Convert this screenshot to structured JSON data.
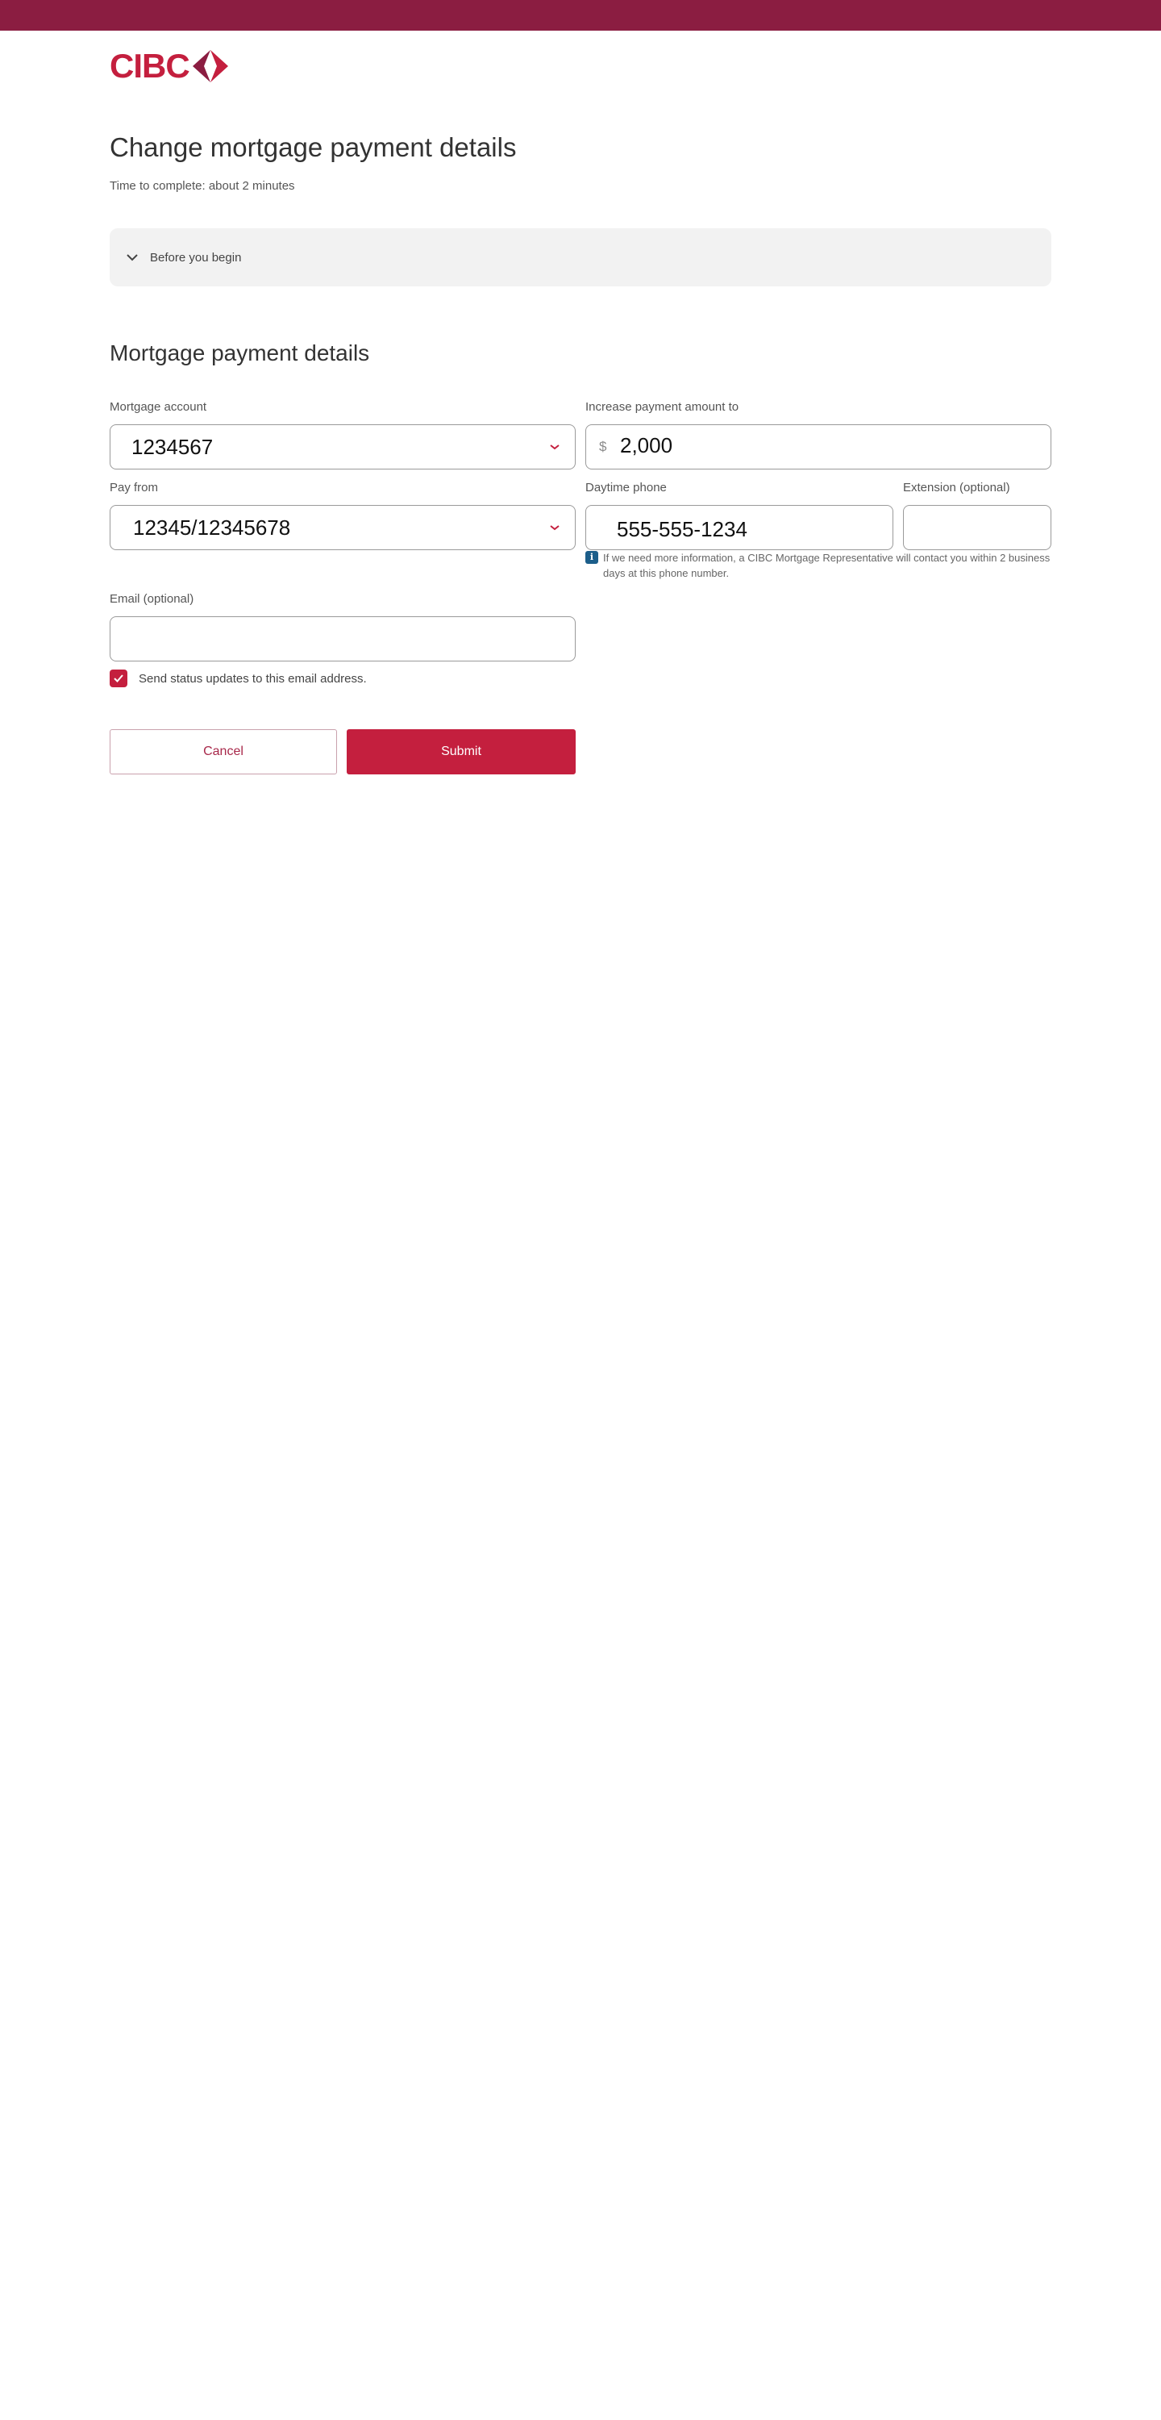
{
  "brand": {
    "name": "CIBC",
    "colors": {
      "topbar": "#8b1d41",
      "accent": "#c41f3e",
      "info": "#1c5e8a"
    }
  },
  "header": {
    "title": "Change mortgage payment details",
    "subtitle": "Time to complete: about 2 minutes"
  },
  "accordion": {
    "label": "Before you begin",
    "icon": "chevron-down-icon"
  },
  "section": {
    "title": "Mortgage payment details"
  },
  "form": {
    "mortgage_account": {
      "label": "Mortgage account",
      "value": "1234567",
      "icon": "chevron-down-icon"
    },
    "increase_payment": {
      "label": "Increase payment amount to",
      "prefix": "$",
      "value": "2,000"
    },
    "pay_from": {
      "label": "Pay from",
      "value": "12345/12345678",
      "icon": "chevron-down-icon"
    },
    "daytime_phone": {
      "label": "Daytime phone",
      "value": "555-555-1234",
      "note": "If we need more information, a CIBC Mortgage Representative will contact you within 2 business days at this phone number.",
      "note_icon": "info-icon"
    },
    "extension": {
      "label": "Extension (optional)",
      "value": ""
    },
    "email": {
      "label": "Email (optional)",
      "value": ""
    },
    "status_updates": {
      "label": "Send status updates to this email address.",
      "checked": true
    }
  },
  "actions": {
    "cancel_label": "Cancel",
    "submit_label": "Submit"
  }
}
